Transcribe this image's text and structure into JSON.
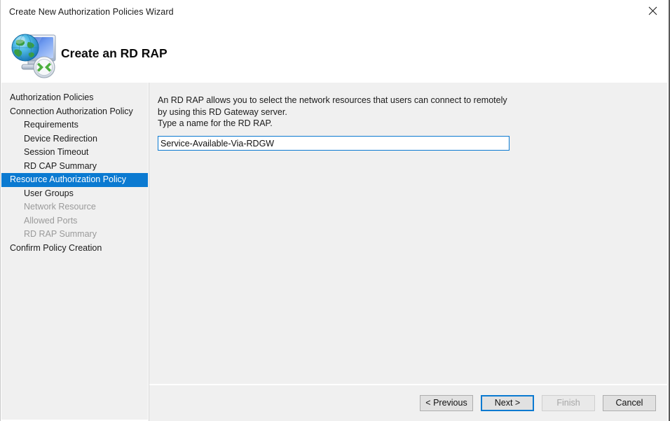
{
  "window": {
    "title": "Create New Authorization Policies Wizard",
    "close_icon": "close-icon"
  },
  "header": {
    "title": "Create an RD RAP",
    "icon": "rd-gateway-globe-monitor-icon"
  },
  "sidebar": {
    "items": [
      {
        "label": "Authorization Policies",
        "indent": false,
        "state": "normal"
      },
      {
        "label": "Connection Authorization Policy",
        "indent": false,
        "state": "normal"
      },
      {
        "label": "Requirements",
        "indent": true,
        "state": "normal"
      },
      {
        "label": "Device Redirection",
        "indent": true,
        "state": "normal"
      },
      {
        "label": "Session Timeout",
        "indent": true,
        "state": "normal"
      },
      {
        "label": "RD CAP Summary",
        "indent": true,
        "state": "normal"
      },
      {
        "label": "Resource Authorization Policy",
        "indent": false,
        "state": "selected"
      },
      {
        "label": "User Groups",
        "indent": true,
        "state": "normal"
      },
      {
        "label": "Network Resource",
        "indent": true,
        "state": "disabled"
      },
      {
        "label": "Allowed Ports",
        "indent": true,
        "state": "disabled"
      },
      {
        "label": "RD RAP Summary",
        "indent": true,
        "state": "disabled"
      },
      {
        "label": "Confirm Policy Creation",
        "indent": false,
        "state": "normal"
      }
    ]
  },
  "main": {
    "description": "An RD RAP allows you to select the network resources that users can connect to remotely by using this RD Gateway server.\nType a name for the RD RAP.",
    "name_field": {
      "value": "Service-Available-Via-RDGW",
      "placeholder": ""
    }
  },
  "footer": {
    "buttons": [
      {
        "label": "< Previous",
        "state": "normal"
      },
      {
        "label": "Next >",
        "state": "focused"
      },
      {
        "label": "Finish",
        "state": "disabled"
      },
      {
        "label": "Cancel",
        "state": "normal"
      }
    ]
  },
  "colors": {
    "accent": "#0b7ad1",
    "surface": "#f0f0f0",
    "window": "#ffffff",
    "text": "#1b1b1b",
    "text_disabled": "#9a9a9a"
  }
}
